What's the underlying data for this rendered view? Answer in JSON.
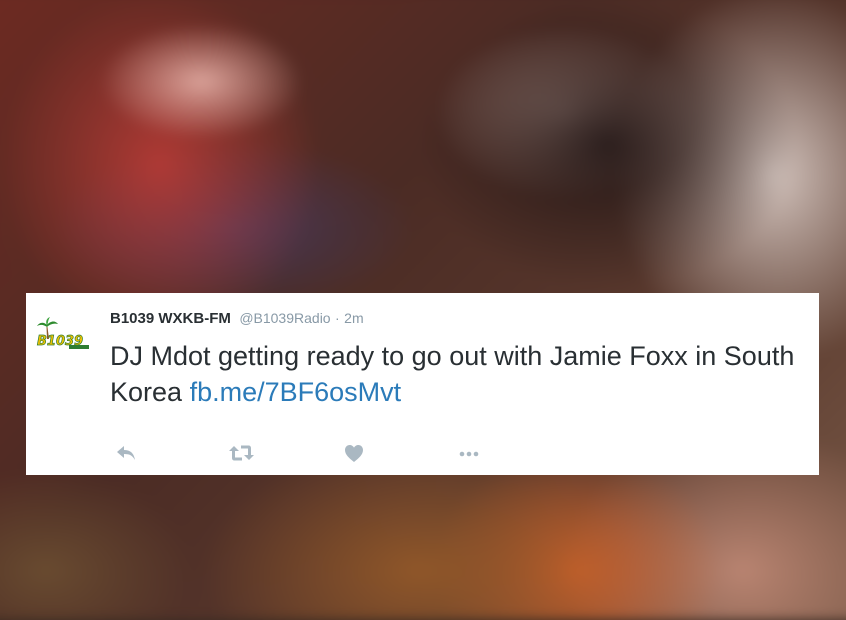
{
  "tweet": {
    "display_name": "B1039 WXKB-FM",
    "handle": "@B1039Radio",
    "separator": "·",
    "time": "2m",
    "text": "DJ Mdot getting ready to go out with Jamie Foxx in South Korea",
    "link": "fb.me/7BF6osMvt",
    "avatar_logo_text": "B1039",
    "accent_color": "#2b7bb9",
    "actions": [
      {
        "name": "reply-icon"
      },
      {
        "name": "retweet-icon"
      },
      {
        "name": "like-icon"
      },
      {
        "name": "more-icon"
      }
    ]
  }
}
